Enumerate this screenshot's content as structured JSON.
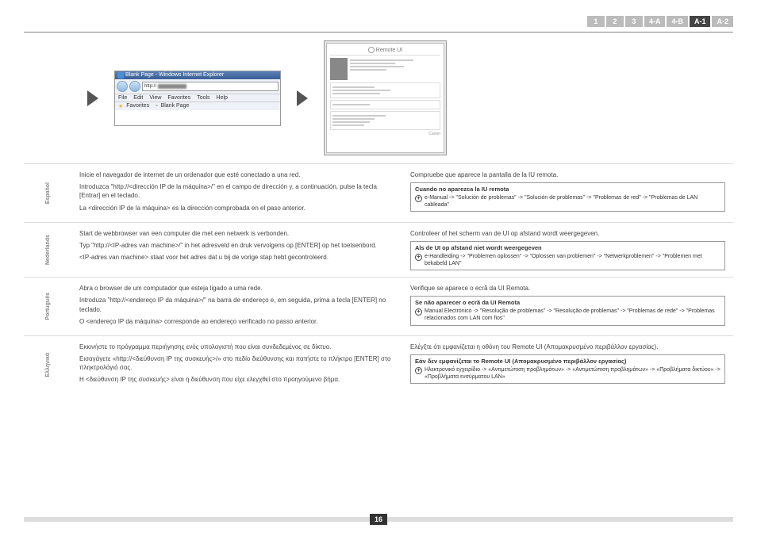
{
  "tabs": [
    "1",
    "2",
    "3",
    "4-A",
    "4-B",
    "A-1",
    "A-2"
  ],
  "activeTab": 5,
  "browser": {
    "title": "Blank Page - Windows Internet Explorer",
    "urlPrefix": "http://",
    "menu": [
      "File",
      "Edit",
      "View",
      "Favorites",
      "Tools",
      "Help"
    ],
    "fav": "Favorites",
    "blank": "Blank Page"
  },
  "remote": {
    "head": "Remote UI",
    "foot": "Canon"
  },
  "langs": [
    {
      "name": "Español",
      "left": [
        "Inicie el navegador de internet de un ordenador que esté conectado a una red.",
        "Introduzca \"http://<dirección IP de la máquina>/\" en el campo de dirección y, a continuación, pulse la tecla [Entrar] en el teclado.",
        "La <dirección IP de la máquina> es la dirección comprobada en el paso anterior."
      ],
      "rightTop": "Compruebe que aparece la pantalla de la IU remota.",
      "noteTitle": "Cuando no aparezca la IU remota",
      "noteBody": "e-Manual -> \"Solución de problemas\" -> \"Solución de problemas\" -> \"Problemas de red\" -> \"Problemas de LAN cableada\""
    },
    {
      "name": "Nederlands",
      "left": [
        "Start de webbrowser van een computer die met een netwerk is verbonden.",
        "Typ \"http://<IP-adres van machine>/\" in het adresveld en druk vervolgens op [ENTER] op het toetsenbord.",
        "<IP-adres van machine> staat voor het adres dat u bij de vorige stap hebt gecontroleerd."
      ],
      "rightTop": "Controleer of het scherm van de UI op afstand wordt weergegeven.",
      "noteTitle": "Als de UI op afstand niet wordt weergegeven",
      "noteBody": "e-Handleiding -> \"Problemen oplossen\" -> \"Oplossen van problemen\" -> \"Netwerkproblemen\" -> \"Problemen met bekabeld LAN\""
    },
    {
      "name": "Português",
      "left": [
        "Abra o browser de um computador que esteja ligado a uma rede.",
        "Introduza \"http://<endereço IP da máquina>/\" na barra de endereço e, em seguida, prima a tecla [ENTER] no teclado.",
        "O <endereço IP da máquina> corresponde ao endereço verificado no passo anterior."
      ],
      "rightTop": "Verifique se aparece o ecrã da UI Remota.",
      "noteTitle": "Se não aparecer o ecrã da UI Remota",
      "noteBody": "Manual Electrónico -> \"Resolução de problemas\" -> \"Resolução de problemas\" -> \"Problemas de rede\" -> \"Problemas relacionados com LAN com fios\""
    },
    {
      "name": "Ελληνικά",
      "left": [
        "Εκκινήστε το πρόγραμμα περιήγησης ενός υπολογιστή που είναι συνδεδεμένος σε δίκτυο.",
        "Εισαγάγετε «http://<διεύθυνση IP της συσκευής>/» στο πεδίο διεύθυνσης και πατήστε το πλήκτρο [ENTER] στο πληκτρολόγιό σας.",
        "Η <διεύθυνση IP της συσκευής> είναι η διεύθυνση που είχε ελεγχθεί στο προηγούμενο βήμα."
      ],
      "rightTop": "Ελέγξτε ότι εμφανίζεται η οθόνη του Remote UI (Απομακρυσμένο περιβάλλον εργασίας).",
      "noteTitle": "Εάν δεν εμφανίζεται το Remote UI (Απομακρυσμένο περιβάλλον εργασίας)",
      "noteBody": "Ηλεκτρονικό εγχειρίδιο -> «Αντιμετώπιση προβλημάτων» -> «Αντιμετώπιση προβλημάτων» -> «Προβλήματα δικτύου» -> «Προβλήματα ενσύρματου LAN»"
    }
  ],
  "page": "16"
}
